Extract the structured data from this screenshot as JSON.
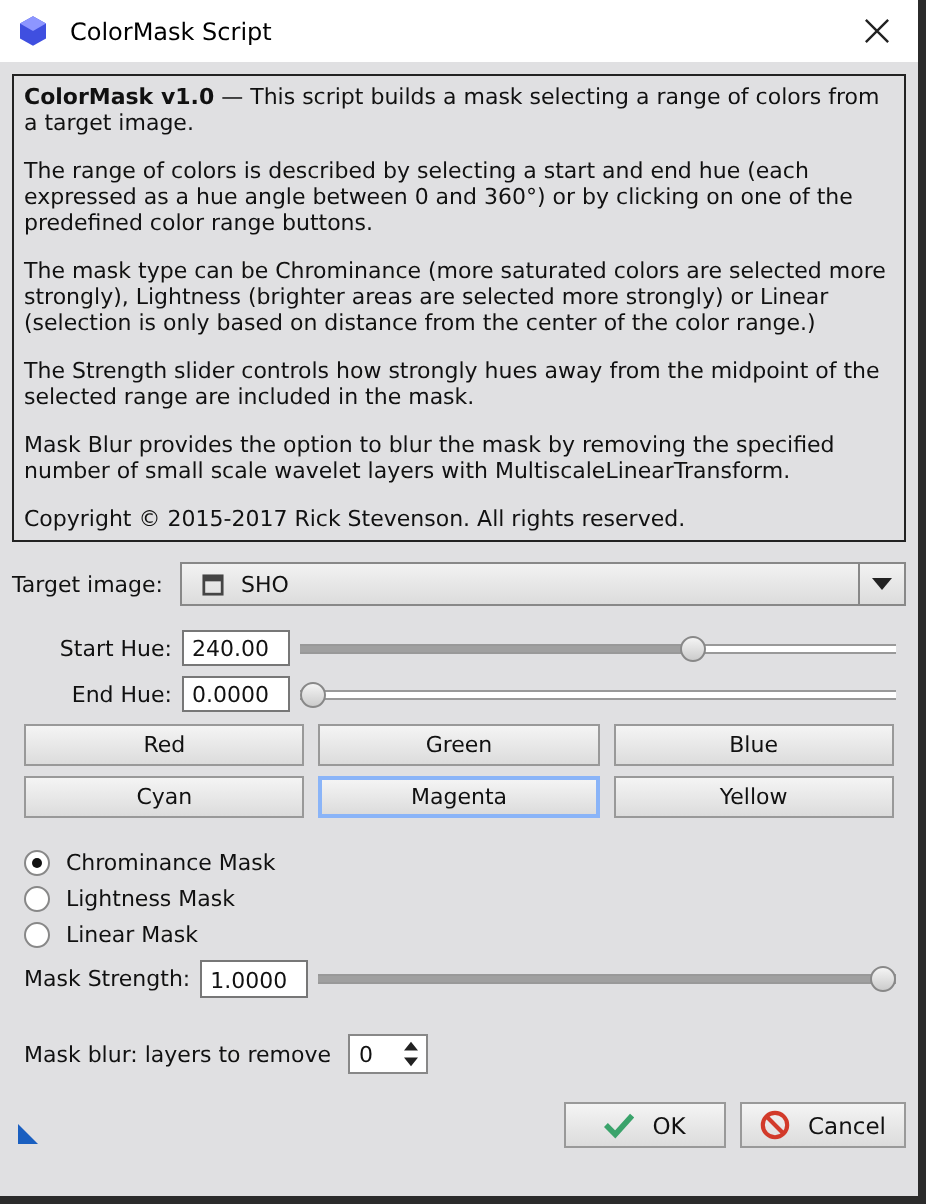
{
  "window": {
    "title": "ColorMask Script"
  },
  "description": [
    "**ColorMask v1.0** — This script builds a mask selecting a range of colors from a target image.",
    "The range of colors is described by selecting a start and end hue (each expressed as a hue angle between 0 and 360°) or by clicking on one of the predefined color range buttons.",
    "The mask type can be Chrominance (more saturated colors are selected more strongly), Lightness (brighter areas are selected more strongly) or Linear (selection is only based on distance from the center of the color range.)",
    "The Strength slider controls how strongly hues away from the midpoint of the selected range are included in the mask.",
    "Mask Blur provides the option to blur the mask by removing the specified number of small scale wavelet layers with MultiscaleLinearTransform.",
    "Copyright © 2015-2017 Rick Stevenson. All rights reserved."
  ],
  "target_image": {
    "label": "Target image:",
    "value": "SHO"
  },
  "hues": [
    {
      "label": "Start Hue:",
      "value": "240.00",
      "level": 0.667
    },
    {
      "label": "End Hue:",
      "value": "0.0000",
      "level": 0
    }
  ],
  "color_buttons": [
    {
      "label": "Red",
      "focused": false
    },
    {
      "label": "Green",
      "focused": false
    },
    {
      "label": "Blue",
      "focused": false
    },
    {
      "label": "Cyan",
      "focused": false
    },
    {
      "label": "Magenta",
      "focused": true
    },
    {
      "label": "Yellow",
      "focused": false
    }
  ],
  "mask_types": [
    {
      "label": "Chrominance Mask",
      "selected": true
    },
    {
      "label": "Lightness Mask",
      "selected": false
    },
    {
      "label": "Linear Mask",
      "selected": false
    }
  ],
  "mask_strength": {
    "label": "Mask Strength:",
    "value": "1.0000",
    "level": 1
  },
  "mask_blur": {
    "label": "Mask blur: layers to remove",
    "value": "0"
  },
  "buttons": [
    {
      "kind": "ok",
      "label": "OK"
    },
    {
      "kind": "cancel",
      "label": "Cancel"
    }
  ]
}
